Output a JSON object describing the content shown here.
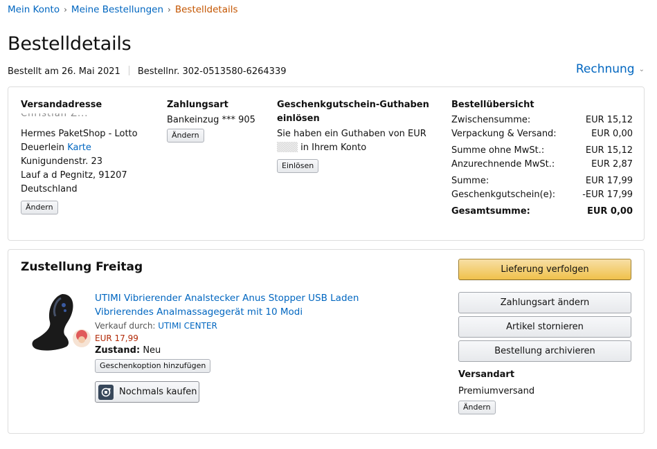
{
  "breadcrumb": {
    "items": [
      "Mein Konto",
      "Meine Bestellungen"
    ],
    "current": "Bestelldetails",
    "separator": "›"
  },
  "page_title": "Bestelldetails",
  "order_meta": {
    "ordered": "Bestellt am 26. Mai 2021",
    "order_number": "Bestellnr. 302-0513580-6264339"
  },
  "invoice": {
    "label": "Rechnung"
  },
  "shipping_address": {
    "heading": "Versandadresse",
    "name_redacted": "Christian Z...",
    "line1": "Hermes PaketShop - Lotto",
    "line2_text": "Deuerlein",
    "map_link": "Karte",
    "line3": "Kunigundenstr. 23",
    "line4": "Lauf a d Pegnitz, 91207",
    "line5": "Deutschland",
    "change_label": "Ändern"
  },
  "payment": {
    "heading": "Zahlungsart",
    "method": "Bankeinzug *** 905",
    "change_label": "Ändern"
  },
  "gift_card": {
    "heading": "Geschenkgutschein-Guthaben einlösen",
    "text_prefix": "Sie haben ein Guthaben von EUR",
    "text_suffix": "in Ihrem Konto",
    "redeem_label": "Einlösen"
  },
  "summary": {
    "heading": "Bestellübersicht",
    "rows": [
      {
        "label": "Zwischensumme:",
        "value": "EUR 15,12"
      },
      {
        "label": "Verpackung & Versand:",
        "value": "EUR 0,00"
      },
      {
        "label": "Summe ohne MwSt.:",
        "value": "EUR 15,12"
      },
      {
        "label": "Anzurechnende MwSt.:",
        "value": "EUR 2,87"
      },
      {
        "label": "Summe:",
        "value": "EUR 17,99"
      },
      {
        "label": "Geschenkgutschein(e):",
        "value": "-EUR 17,99"
      },
      {
        "label": "Gesamtsumme:",
        "value": "EUR 0,00"
      }
    ]
  },
  "delivery": {
    "heading": "Zustellung Freitag",
    "product": {
      "title": "UTIMI Vibrierender Analstecker Anus Stopper USB Laden Vibrierendes Analmassagegerät mit 10 Modi",
      "seller_label": "Verkauf durch:",
      "seller_name": "UTIMI CENTER",
      "price": "EUR 17,99",
      "condition_label": "Zustand:",
      "condition_value": "Neu",
      "gift_option_label": "Geschenkoption hinzufügen",
      "buy_again_label": "Nochmals kaufen"
    },
    "actions": {
      "track": "Lieferung verfolgen",
      "change_payment": "Zahlungsart ändern",
      "cancel": "Artikel stornieren",
      "archive": "Bestellung archivieren"
    },
    "shipping_method": {
      "heading": "Versandart",
      "value": "Premiumversand",
      "change_label": "Ändern"
    }
  },
  "colors": {
    "link": "#0066c0",
    "breadcrumb_current": "#c45500",
    "price": "#b12704",
    "primary_button": "#f0c14b"
  },
  "icons": [
    "chevron-down-icon",
    "buy-again-icon",
    "product-image"
  ]
}
